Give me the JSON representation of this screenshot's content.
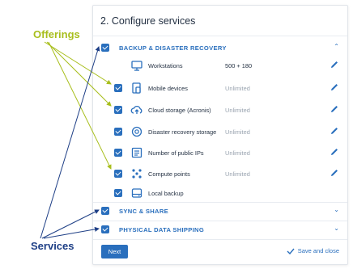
{
  "panel": {
    "title": "2. Configure services",
    "next_label": "Next",
    "save_label": "Save and close"
  },
  "services": [
    {
      "label": "BACKUP & DISASTER RECOVERY",
      "expanded": true,
      "checked": true
    },
    {
      "label": "SYNC & SHARE",
      "expanded": false,
      "checked": true
    },
    {
      "label": "PHYSICAL DATA SHIPPING",
      "expanded": false,
      "checked": true
    }
  ],
  "offerings": [
    {
      "label": "Workstations",
      "value": "500 + 180",
      "icon": "monitor-icon",
      "editable": true
    },
    {
      "label": "Mobile devices",
      "value": "Unlimited",
      "icon": "mobile-devices-icon",
      "editable": true
    },
    {
      "label": "Cloud storage (Acronis)",
      "value": "Unlimited",
      "icon": "cloud-upload-icon",
      "editable": true
    },
    {
      "label": "Disaster recovery storage",
      "value": "Unlimited",
      "icon": "disaster-recovery-icon",
      "editable": true
    },
    {
      "label": "Number of public IPs",
      "value": "Unlimited",
      "icon": "public-ip-icon",
      "editable": true
    },
    {
      "label": "Compute points",
      "value": "Unlimited",
      "icon": "compute-points-icon",
      "editable": true
    },
    {
      "label": "Local backup",
      "value": "",
      "icon": "local-backup-icon",
      "editable": false
    }
  ],
  "annotations": {
    "offerings_label": "Offerings",
    "services_label": "Services",
    "offerings_color": "#a8be1c",
    "services_color": "#1e3f86"
  },
  "colors": {
    "accent": "#2a6fbd",
    "text": "#243143",
    "muted": "#9aa4b0"
  }
}
